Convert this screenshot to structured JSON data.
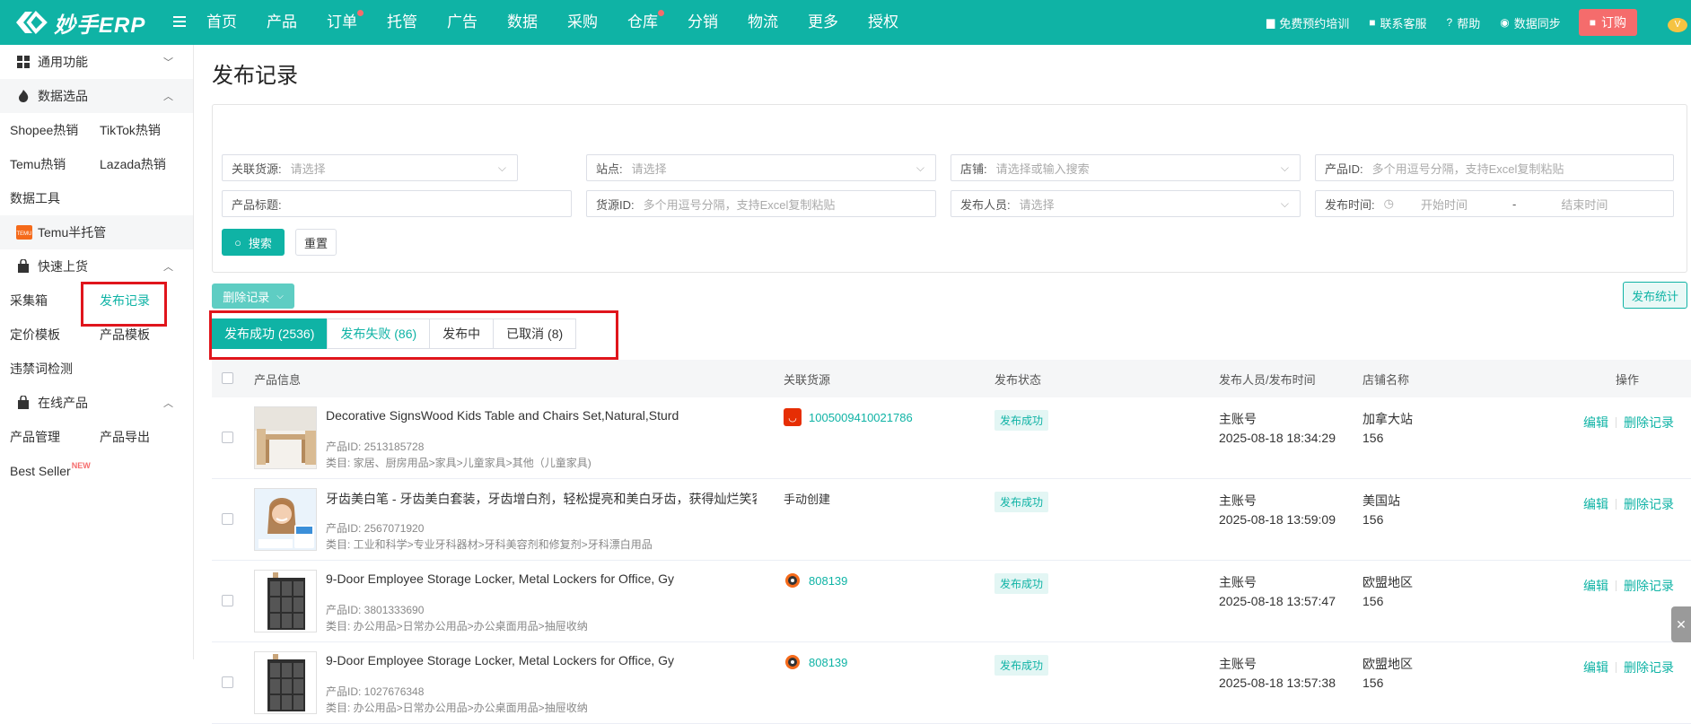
{
  "app": {
    "logo_text": "妙手ERP",
    "nav": [
      "首页",
      "产品",
      "订单",
      "托管",
      "广告",
      "数据",
      "采购",
      "仓库",
      "分销",
      "物流",
      "更多",
      "授权"
    ],
    "nav_dots": [
      "订单",
      "仓库"
    ],
    "top_right": {
      "training": "免费预约培训",
      "contact": "联系客服",
      "help": "帮助",
      "sync": "数据同步",
      "order": "订购"
    }
  },
  "sidebar": {
    "groups": [
      {
        "label": "通用功能",
        "expanded": false
      },
      {
        "label": "数据选品",
        "expanded": true
      },
      {
        "label": "Temu半托管"
      },
      {
        "label": "快速上货",
        "expanded": true
      },
      {
        "label": "在线产品",
        "expanded": true
      }
    ],
    "data_pick": [
      [
        "Shopee热销",
        "TikTok热销"
      ],
      [
        "Temu热销",
        "Lazada热销"
      ],
      [
        "数据工具"
      ]
    ],
    "quick_upload": [
      [
        "采集箱",
        "发布记录"
      ],
      [
        "定价模板",
        "产品模板"
      ],
      [
        "违禁词检测"
      ]
    ],
    "online_products": [
      [
        "产品管理",
        "产品导出"
      ],
      [
        "Best Seller"
      ]
    ],
    "new_badge": "NEW",
    "active_item": "发布记录"
  },
  "page": {
    "title": "发布记录",
    "filters": {
      "source": {
        "label": "关联货源:",
        "placeholder": "请选择"
      },
      "site": {
        "label": "站点:",
        "placeholder": "请选择"
      },
      "store": {
        "label": "店铺:",
        "placeholder": "请选择或输入搜索"
      },
      "product_id": {
        "label": "产品ID:",
        "placeholder": "多个用逗号分隔，支持Excel复制粘贴"
      },
      "product_title": {
        "label": "产品标题:",
        "placeholder": ""
      },
      "source_id": {
        "label": "货源ID:",
        "placeholder": "多个用逗号分隔，支持Excel复制粘贴"
      },
      "publisher": {
        "label": "发布人员:",
        "placeholder": "请选择"
      },
      "publish_time": {
        "label": "发布时间:",
        "start": "开始时间",
        "sep": "-",
        "end": "结束时间"
      }
    },
    "search_btn": "搜索",
    "reset_btn": "重置",
    "delete_btn": "删除记录",
    "stats_btn": "发布统计",
    "tabs": [
      {
        "label": "发布成功 (2536)",
        "active": true
      },
      {
        "label": "发布失败 (86)"
      },
      {
        "label": "发布中"
      },
      {
        "label": "已取消 (8)"
      }
    ],
    "columns": {
      "info": "产品信息",
      "source": "关联货源",
      "status": "发布状态",
      "publisher": "发布人员/发布时间",
      "store": "店铺名称",
      "ops": "操作"
    },
    "rows": [
      {
        "title": "Decorative SignsWood Kids Table and Chairs Set,Natural,Sturd",
        "pid": "产品ID: 2513185728",
        "cat": "类目: 家居、厨房用品>家具>儿童家具>其他（儿童家具)",
        "source_type": "ali",
        "source_text": "1005009410021786",
        "status": "发布成功",
        "user": "主账号",
        "time": "2025-08-18 18:34:29",
        "store": "加拿大站",
        "store_no": "156"
      },
      {
        "title": "牙齿美白笔 - 牙齿美白套装，牙齿增白剂，轻松提亮和美白牙齿，获得灿烂笑容",
        "pid": "产品ID: 2567071920",
        "cat": "类目: 工业和科学>专业牙科器材>牙科美容剂和修复剂>牙科漂白用品",
        "source_type": "manual",
        "source_text": "手动创建",
        "status": "发布成功",
        "user": "主账号",
        "time": "2025-08-18 13:59:09",
        "store": "美国站",
        "store_no": "156"
      },
      {
        "title": "9-Door Employee Storage Locker, Metal Lockers for Office, Gy",
        "pid": "产品ID: 3801333690",
        "cat": "类目: 办公用品>日常办公用品>办公桌面用品>抽屉收纳",
        "source_type": "temu",
        "source_text": "808139",
        "status": "发布成功",
        "user": "主账号",
        "time": "2025-08-18 13:57:47",
        "store": "欧盟地区",
        "store_no": "156"
      },
      {
        "title": "9-Door Employee Storage Locker, Metal Lockers for Office, Gy",
        "pid": "产品ID: 1027676348",
        "cat": "类目: 办公用品>日常办公用品>办公桌面用品>抽屉收纳",
        "source_type": "temu",
        "source_text": "808139",
        "status": "发布成功",
        "user": "主账号",
        "time": "2025-08-18 13:57:38",
        "store": "欧盟地区",
        "store_no": "156"
      }
    ],
    "op_edit": "编辑",
    "op_delete": "删除记录"
  }
}
